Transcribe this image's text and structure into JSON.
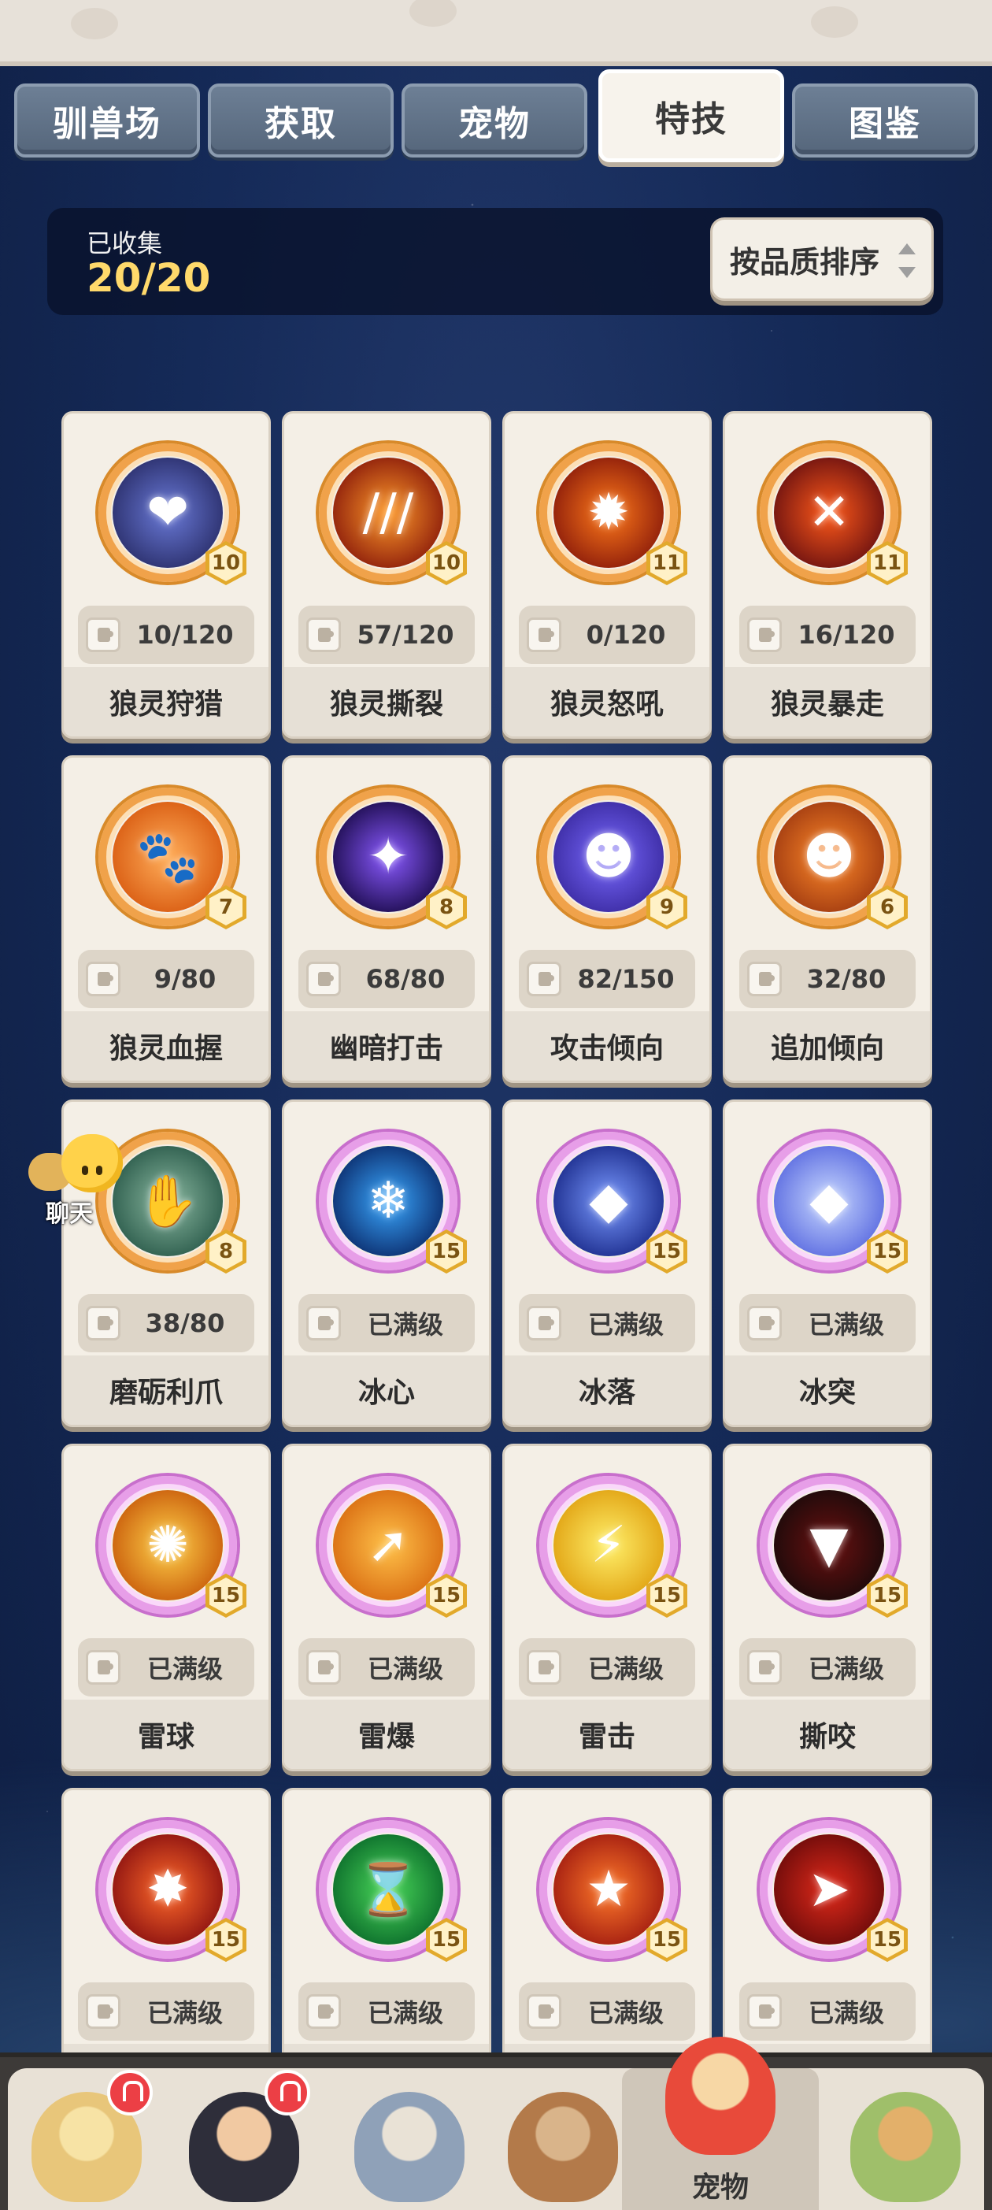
{
  "tabs": [
    {
      "label": "驯兽场",
      "active": false
    },
    {
      "label": "获取",
      "active": false
    },
    {
      "label": "宠物",
      "active": false
    },
    {
      "label": "特技",
      "active": true
    },
    {
      "label": "图鉴",
      "active": false
    }
  ],
  "collection": {
    "label": "已收集",
    "value": "20/20"
  },
  "sort_button": {
    "label": "按品质排序",
    "icon": "sort-arrows-icon"
  },
  "skills": [
    {
      "name": "狼灵狩猎",
      "level": "10",
      "progress": "10/120",
      "ring": "orange",
      "icon": "wolf-heart-icon",
      "colors": [
        "#2a2e6a",
        "#6a7ad8"
      ],
      "glyph": "❤"
    },
    {
      "name": "狼灵撕裂",
      "level": "10",
      "progress": "57/120",
      "ring": "orange",
      "icon": "claw-slash-icon",
      "colors": [
        "#8a1a0a",
        "#ff9a2a"
      ],
      "glyph": "///"
    },
    {
      "name": "狼灵怒吼",
      "level": "11",
      "progress": "0/120",
      "ring": "orange",
      "icon": "explosion-icon",
      "colors": [
        "#8a1a0a",
        "#ff7a1a"
      ],
      "glyph": "✹"
    },
    {
      "name": "狼灵暴走",
      "level": "11",
      "progress": "16/120",
      "ring": "orange",
      "icon": "rampage-claw-icon",
      "colors": [
        "#6a1010",
        "#ff5a1a"
      ],
      "glyph": "✕"
    },
    {
      "name": "狼灵血握",
      "level": "7",
      "progress": "9/80",
      "ring": "orange",
      "icon": "paw-icon",
      "colors": [
        "#d85a10",
        "#ffae5a"
      ],
      "glyph": "🐾"
    },
    {
      "name": "幽暗打击",
      "level": "8",
      "progress": "68/80",
      "ring": "orange",
      "icon": "dark-strike-icon",
      "colors": [
        "#1a0a4a",
        "#8a5aff"
      ],
      "glyph": "✦"
    },
    {
      "name": "攻击倾向",
      "level": "9",
      "progress": "82/150",
      "ring": "orange",
      "icon": "purple-beast-icon",
      "colors": [
        "#3a2aa0",
        "#7a6aff"
      ],
      "glyph": "☻"
    },
    {
      "name": "追加倾向",
      "level": "6",
      "progress": "32/80",
      "ring": "orange",
      "icon": "fox-icon",
      "colors": [
        "#a03a10",
        "#ff8a2a"
      ],
      "glyph": "☻"
    },
    {
      "name": "磨砺利爪",
      "level": "8",
      "progress": "38/80",
      "ring": "orange",
      "icon": "sharp-claw-icon",
      "colors": [
        "#2a5a4a",
        "#8ab8a0"
      ],
      "glyph": "✋"
    },
    {
      "name": "冰心",
      "level": "15",
      "progress": "已满级",
      "ring": "pink",
      "icon": "ice-heart-icon",
      "colors": [
        "#0a2a6a",
        "#3aa8ff"
      ],
      "glyph": "❄"
    },
    {
      "name": "冰落",
      "level": "15",
      "progress": "已满级",
      "ring": "pink",
      "icon": "ice-fall-icon",
      "colors": [
        "#1a2a8a",
        "#7a9aff"
      ],
      "glyph": "◆"
    },
    {
      "name": "冰突",
      "level": "15",
      "progress": "已满级",
      "ring": "pink",
      "icon": "ice-crystal-icon",
      "colors": [
        "#5a6ae0",
        "#c8d8ff"
      ],
      "glyph": "◆"
    },
    {
      "name": "雷球",
      "level": "15",
      "progress": "已满级",
      "ring": "pink",
      "icon": "thunder-ball-icon",
      "colors": [
        "#c85a0a",
        "#ffd24a"
      ],
      "glyph": "✺"
    },
    {
      "name": "雷爆",
      "level": "15",
      "progress": "已满级",
      "ring": "pink",
      "icon": "thunder-burst-icon",
      "colors": [
        "#d86a10",
        "#ffc24a"
      ],
      "glyph": "➚"
    },
    {
      "name": "雷击",
      "level": "15",
      "progress": "已满级",
      "ring": "pink",
      "icon": "thunder-strike-icon",
      "colors": [
        "#e0a010",
        "#fff06a"
      ],
      "glyph": "⚡"
    },
    {
      "name": "撕咬",
      "level": "15",
      "progress": "已满级",
      "ring": "pink",
      "icon": "bite-icon",
      "colors": [
        "#1a0a0a",
        "#6a1010"
      ],
      "glyph": "▼"
    },
    {
      "name": "",
      "level": "15",
      "progress": "已满级",
      "ring": "pink",
      "icon": "impact-icon",
      "colors": [
        "#8a1010",
        "#ff6a2a"
      ],
      "glyph": "✸"
    },
    {
      "name": "",
      "level": "15",
      "progress": "已满级",
      "ring": "pink",
      "icon": "hourglass-icon",
      "colors": [
        "#0a6a2a",
        "#4ad85a"
      ],
      "glyph": "⌛"
    },
    {
      "name": "",
      "level": "15",
      "progress": "已满级",
      "ring": "pink",
      "icon": "stun-fist-icon",
      "colors": [
        "#a01a10",
        "#ff7a2a"
      ],
      "glyph": "★"
    },
    {
      "name": "",
      "level": "15",
      "progress": "已满级",
      "ring": "pink",
      "icon": "dash-icon",
      "colors": [
        "#6a0a0a",
        "#e02a1a"
      ],
      "glyph": "➤"
    }
  ],
  "chat": {
    "label": "聊天",
    "icon": "chat-bubble-icon"
  },
  "bottom_nav": [
    {
      "label": "",
      "icon": "blonde-hero-avatar-icon",
      "notify": true,
      "active": false,
      "colors": [
        "#e8c67a",
        "#f7e3a5"
      ]
    },
    {
      "label": "",
      "icon": "dark-hair-hero-avatar-icon",
      "notify": true,
      "active": false,
      "colors": [
        "#2e2e3a",
        "#f1c9a2"
      ]
    },
    {
      "label": "",
      "icon": "sword-shield-icon",
      "notify": false,
      "active": false,
      "colors": [
        "#8fa1b8",
        "#e9e2d6"
      ]
    },
    {
      "label": "",
      "icon": "old-master-avatar-icon",
      "notify": false,
      "active": false,
      "colors": [
        "#b37a4a",
        "#d9b48a"
      ]
    },
    {
      "label": "宠物",
      "icon": "red-dino-pet-icon",
      "notify": false,
      "active": true,
      "colors": [
        "#e84a3a",
        "#f7d7a5"
      ]
    },
    {
      "label": "",
      "icon": "horned-totem-avatar-icon",
      "notify": false,
      "active": false,
      "colors": [
        "#9fbf6a",
        "#e3b06a"
      ]
    }
  ]
}
